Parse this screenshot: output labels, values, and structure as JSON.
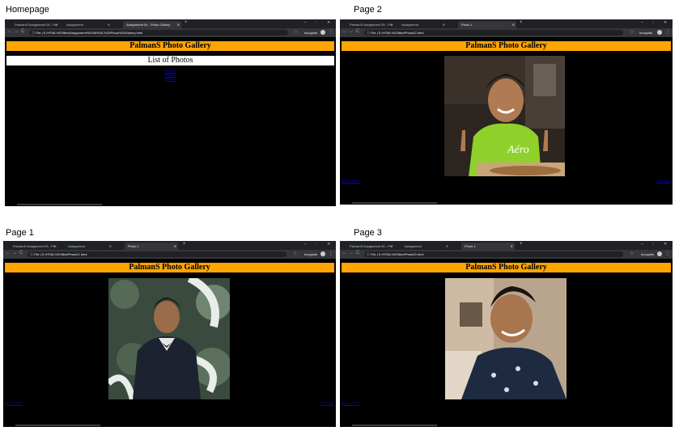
{
  "panels": {
    "homepage": {
      "caption": "Homepage",
      "tabs": [
        "PalmanS Assignment 05 - Ph",
        "Assignment",
        "Assignment 04 - Photo Gallery"
      ],
      "url": "E:/HTML%20files/Assignment%2005%20-%20Photo%20Gallery.html",
      "gallery_title": "PalmanS Photo Gallery",
      "list_title": "List of Photos",
      "photo_links": [
        "Photo1",
        "Photo2",
        "Photo3"
      ],
      "incognito": "Incognito"
    },
    "page1": {
      "caption": "Page 1",
      "tabs": [
        "PalmanS Assignment 05 - Ph",
        "Assignment",
        "Photo 1"
      ],
      "url": "E:/HTML%20files/Photo01.html",
      "gallery_title": "PalmanS Photo Gallery",
      "prev_link": "Back to home",
      "next_link": "Next Page",
      "incognito": "Incognito"
    },
    "page2": {
      "caption": "Page 2",
      "tabs": [
        "PalmanS Assignment 05 - Ph",
        "Assignment",
        "Photo 1"
      ],
      "url": "E:/HTML%20files/Photo02.html",
      "gallery_title": "PalmanS Photo Gallery",
      "prev_link": "Back to home",
      "next_link": "Next Page",
      "incognito": "Incognito"
    },
    "page3": {
      "caption": "Page 3",
      "tabs": [
        "PalmanS Assignment 05 - Ph",
        "Assignment",
        "Photo 1"
      ],
      "url": "E:/HTML%20files/Photo03.html",
      "gallery_title": "PalmanS Photo Gallery",
      "prev_link": "Back to home",
      "incognito": "Incognito"
    }
  },
  "icons": {
    "back": "←",
    "forward": "→",
    "reload": "C",
    "info": "ⓘ",
    "star": "☆",
    "menu": "⋮",
    "minimize": "–",
    "maximize": "▫",
    "close": "✕",
    "new_tab": "+"
  },
  "colors": {
    "header_bg": "#ffa500",
    "page_bg": "#000000",
    "link": "#0000ee",
    "chrome_dark": "#202124"
  }
}
